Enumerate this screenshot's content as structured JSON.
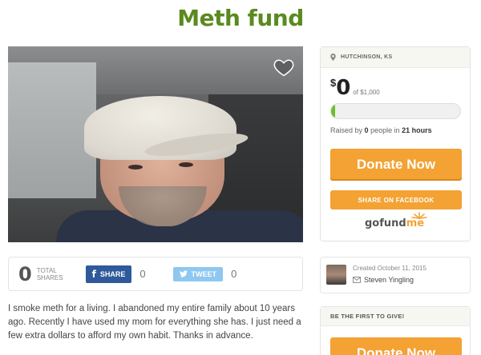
{
  "page": {
    "title": "Meth fund"
  },
  "photo": {
    "alt": ""
  },
  "shares": {
    "count": "0",
    "label_line1": "TOTAL",
    "label_line2": "SHARES",
    "facebook_label": "SHARE",
    "facebook_count": "0",
    "twitter_label": "TWEET",
    "twitter_count": "0"
  },
  "story": "I smoke meth for a living. I abandoned my entire family about 10 years ago. Recently I have used my mom for everything she has. I just need a few extra dollars to afford my own habit. Thanks in advance.",
  "sidebar": {
    "location": "HUTCHINSON, KS",
    "currency": "$",
    "raised": "0",
    "goal": "of $1,000",
    "progress_fraction": 0.03,
    "raised_by_prefix": "Raised by",
    "people": "0",
    "people_suffix": "people in",
    "hours": "21 hours",
    "donate_label": "Donate Now",
    "share_facebook_label": "SHARE ON FACEBOOK",
    "logo_go": "gofund",
    "logo_me": "me"
  },
  "creator": {
    "created": "Created October 11, 2015",
    "name": "Steven Yingling"
  },
  "first_to_give": {
    "header": "BE THE FIRST TO GIVE!",
    "donate_label": "Donate Now"
  },
  "colors": {
    "brand_green": "#5a8a1f",
    "donate_orange": "#f3a233",
    "facebook_blue": "#2f5a9a",
    "twitter_blue": "#8ec7ef",
    "progress_green": "#6bbf2e"
  }
}
